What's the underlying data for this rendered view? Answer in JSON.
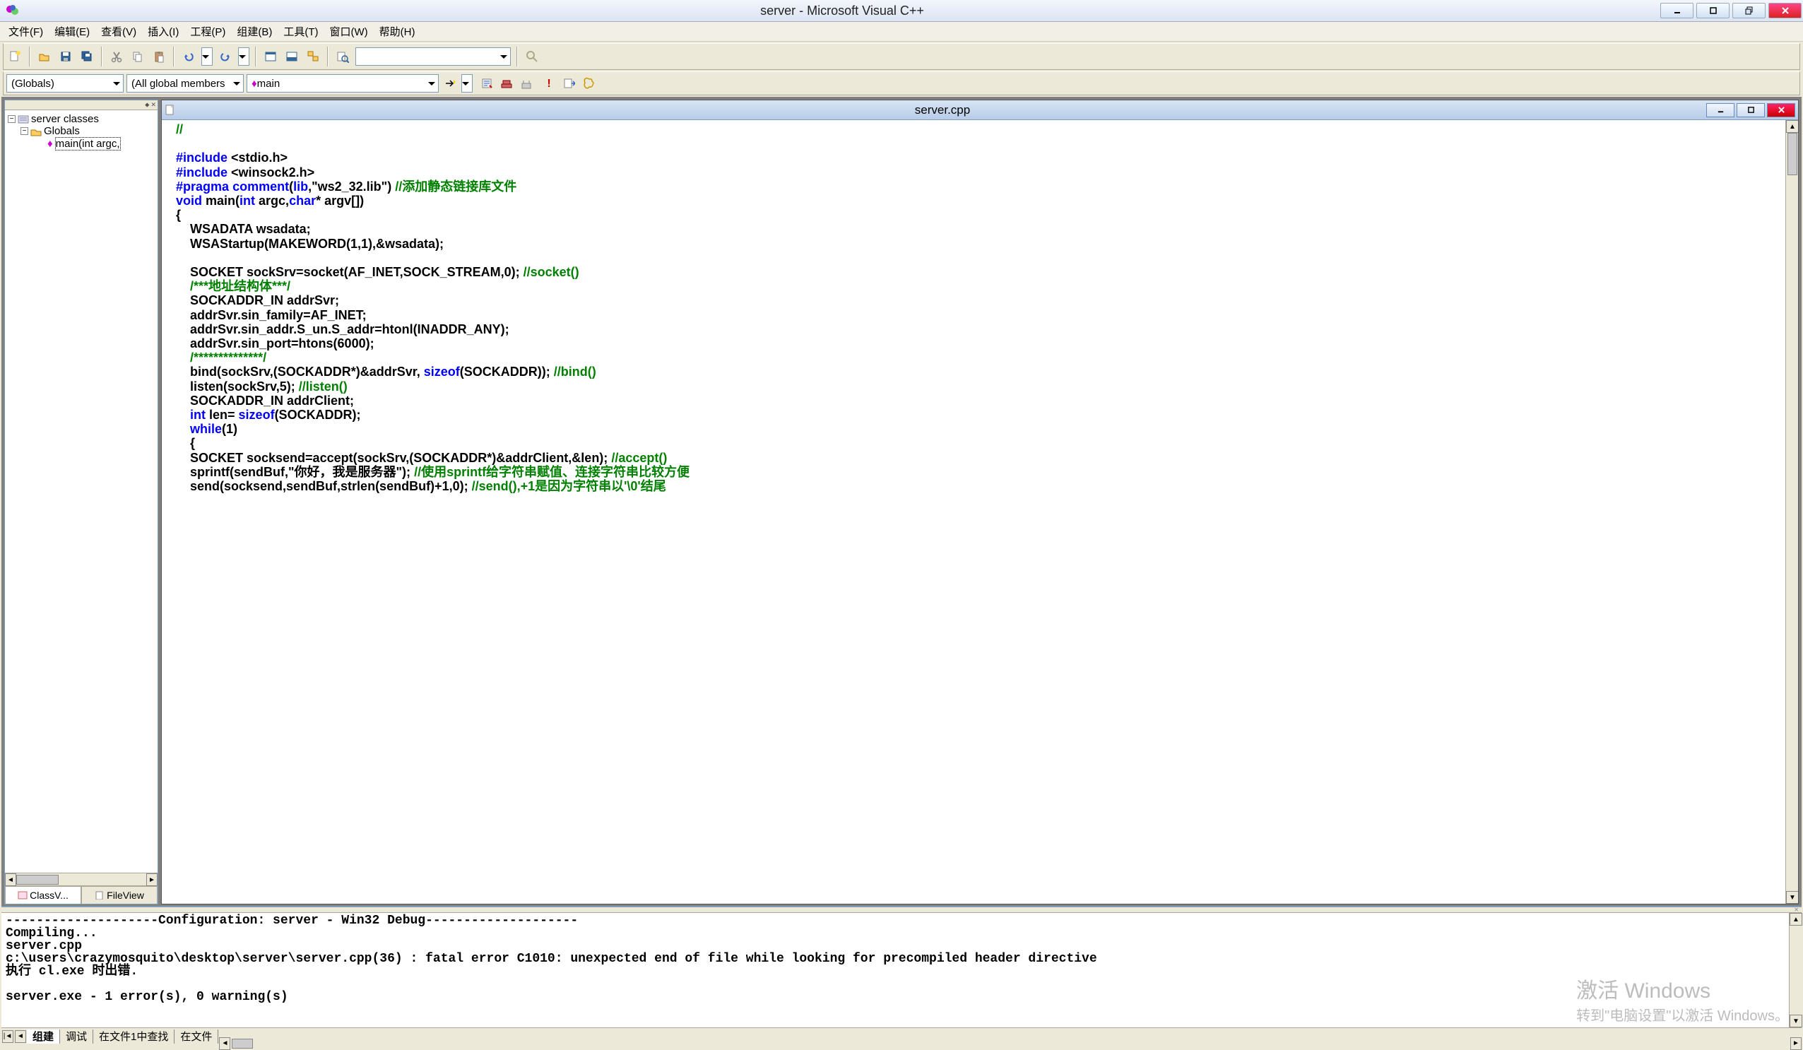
{
  "title": "server - Microsoft Visual C++",
  "menus": [
    "文件(F)",
    "编辑(E)",
    "查看(V)",
    "插入(I)",
    "工程(P)",
    "组建(B)",
    "工具(T)",
    "窗口(W)",
    "帮助(H)"
  ],
  "combo1": "(Globals)",
  "combo2": "(All global members",
  "combo3": "main",
  "tree": {
    "root": "server classes",
    "child1": "Globals",
    "child2": "main(int argc,"
  },
  "sidebar_tabs": {
    "classview": "ClassV...",
    "fileview": "FileView"
  },
  "doc_title": "server.cpp",
  "code_lines": [
    {
      "segs": [
        {
          "t": "//",
          "c": "cm"
        }
      ]
    },
    {
      "segs": [
        {
          "t": "",
          "c": ""
        }
      ]
    },
    {
      "segs": [
        {
          "t": "#include",
          "c": "kw"
        },
        {
          "t": " <stdio.h>",
          "c": ""
        }
      ]
    },
    {
      "segs": [
        {
          "t": "#include",
          "c": "kw"
        },
        {
          "t": " <winsock2.h>",
          "c": ""
        }
      ]
    },
    {
      "segs": [
        {
          "t": "#pragma",
          "c": "kw"
        },
        {
          "t": " ",
          "c": ""
        },
        {
          "t": "comment",
          "c": "kw"
        },
        {
          "t": "(",
          "c": ""
        },
        {
          "t": "lib",
          "c": "kw"
        },
        {
          "t": ",\"ws2_32.lib\") ",
          "c": ""
        },
        {
          "t": "//添加静态链接库文件",
          "c": "cm"
        }
      ]
    },
    {
      "segs": [
        {
          "t": "void",
          "c": "kw"
        },
        {
          "t": " main(",
          "c": ""
        },
        {
          "t": "int",
          "c": "kw"
        },
        {
          "t": " argc,",
          "c": ""
        },
        {
          "t": "char",
          "c": "kw"
        },
        {
          "t": "* argv[])",
          "c": ""
        }
      ]
    },
    {
      "segs": [
        {
          "t": "{",
          "c": ""
        }
      ]
    },
    {
      "segs": [
        {
          "t": "    WSADATA wsadata;",
          "c": ""
        }
      ]
    },
    {
      "segs": [
        {
          "t": "    WSAStartup(MAKEWORD(1,1),&wsadata);",
          "c": ""
        }
      ]
    },
    {
      "segs": [
        {
          "t": "",
          "c": ""
        }
      ]
    },
    {
      "segs": [
        {
          "t": "    SOCKET sockSrv=socket(AF_INET,SOCK_STREAM,0); ",
          "c": ""
        },
        {
          "t": "//socket()",
          "c": "cm"
        }
      ]
    },
    {
      "segs": [
        {
          "t": "    ",
          "c": ""
        },
        {
          "t": "/***地址结构体***/",
          "c": "cm"
        }
      ]
    },
    {
      "segs": [
        {
          "t": "    SOCKADDR_IN addrSvr;",
          "c": ""
        }
      ]
    },
    {
      "segs": [
        {
          "t": "    addrSvr.sin_family=AF_INET;",
          "c": ""
        }
      ]
    },
    {
      "segs": [
        {
          "t": "    addrSvr.sin_addr.S_un.S_addr=htonl(INADDR_ANY);",
          "c": ""
        }
      ]
    },
    {
      "segs": [
        {
          "t": "    addrSvr.sin_port=htons(6000);",
          "c": ""
        }
      ]
    },
    {
      "segs": [
        {
          "t": "    ",
          "c": ""
        },
        {
          "t": "/**************/",
          "c": "cm"
        }
      ]
    },
    {
      "segs": [
        {
          "t": "    bind(sockSrv,(SOCKADDR*)&addrSvr, ",
          "c": ""
        },
        {
          "t": "sizeof",
          "c": "kw"
        },
        {
          "t": "(SOCKADDR)); ",
          "c": ""
        },
        {
          "t": "//bind()",
          "c": "cm"
        }
      ]
    },
    {
      "segs": [
        {
          "t": "    listen(sockSrv,5); ",
          "c": ""
        },
        {
          "t": "//listen()",
          "c": "cm"
        }
      ]
    },
    {
      "segs": [
        {
          "t": "    SOCKADDR_IN addrClient;",
          "c": ""
        }
      ]
    },
    {
      "segs": [
        {
          "t": "    ",
          "c": ""
        },
        {
          "t": "int",
          "c": "kw"
        },
        {
          "t": " len= ",
          "c": ""
        },
        {
          "t": "sizeof",
          "c": "kw"
        },
        {
          "t": "(SOCKADDR);",
          "c": ""
        }
      ]
    },
    {
      "segs": [
        {
          "t": "    ",
          "c": ""
        },
        {
          "t": "while",
          "c": "kw"
        },
        {
          "t": "(1)",
          "c": ""
        }
      ]
    },
    {
      "segs": [
        {
          "t": "    {",
          "c": ""
        }
      ]
    },
    {
      "segs": [
        {
          "t": "    SOCKET socksend=accept(sockSrv,(SOCKADDR*)&addrClient,&len); ",
          "c": ""
        },
        {
          "t": "//accept()",
          "c": "cm"
        }
      ]
    },
    {
      "segs": [
        {
          "t": "    sprintf(sendBuf,\"你好，我是服务器\"); ",
          "c": ""
        },
        {
          "t": "//使用sprintf给字符串赋值、连接字符串比较方便",
          "c": "cm"
        }
      ]
    },
    {
      "segs": [
        {
          "t": "    send(socksend,sendBuf,strlen(sendBuf)+1,0); ",
          "c": ""
        },
        {
          "t": "//send(),+1是因为字符串以'\\0'结尾",
          "c": "cm"
        }
      ]
    }
  ],
  "output_lines": [
    "--------------------Configuration: server - Win32 Debug--------------------",
    "Compiling...",
    "server.cpp",
    "c:\\users\\crazymosquito\\desktop\\server\\server.cpp(36) : fatal error C1010: unexpected end of file while looking for precompiled header directive",
    "执行 cl.exe 时出错.",
    "",
    "server.exe - 1 error(s), 0 warning(s)"
  ],
  "output_tabs": [
    "组建",
    "调试",
    "在文件1中查找",
    "在文件"
  ],
  "watermark": {
    "big": "激活 Windows",
    "small": "转到\"电脑设置\"以激活 Windows。"
  }
}
